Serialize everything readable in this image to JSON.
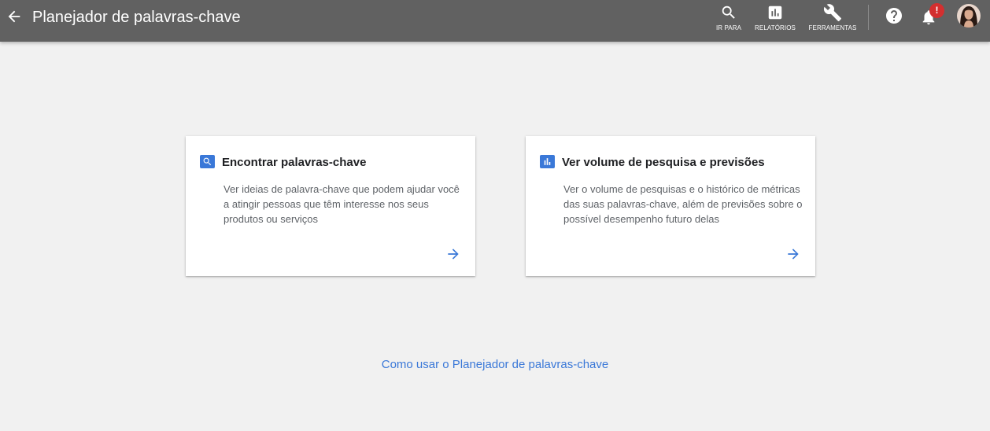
{
  "header": {
    "title": "Planejador de palavras-chave",
    "tools": [
      {
        "label": "IR PARA",
        "icon": "search-icon"
      },
      {
        "label": "RELATÓRIOS",
        "icon": "bar-chart-icon"
      },
      {
        "label": "FERRAMENTAS",
        "icon": "wrench-icon"
      }
    ],
    "notification_badge": "!"
  },
  "cards": [
    {
      "icon": "search-icon",
      "title": "Encontrar palavras-chave",
      "description": "Ver ideias de palavra-chave que podem ajudar você a atingir pessoas que têm interesse nos seus produtos ou serviços"
    },
    {
      "icon": "bar-chart-icon",
      "title": "Ver volume de pesquisa e previsões",
      "description": "Ver o volume de pesquisas e o histórico de métricas das suas palavras-chave, além de previsões sobre o possível desempenho futuro delas"
    }
  ],
  "help_link": "Como usar o Planejador de palavras-chave",
  "colors": {
    "topbar": "#616161",
    "accent": "#3a78d8",
    "badge": "#d32f2f",
    "background": "#f1f1f1"
  }
}
